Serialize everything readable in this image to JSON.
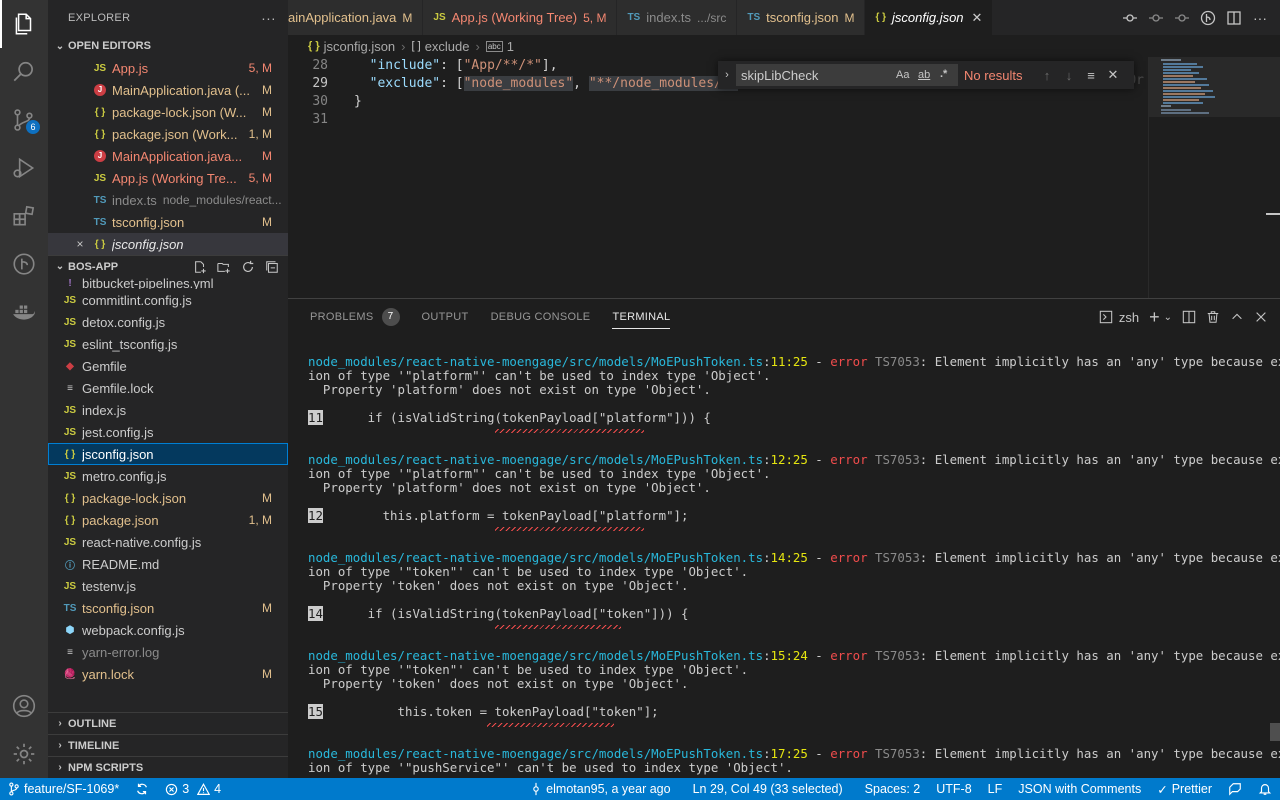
{
  "activity": {
    "scm_badge": "6"
  },
  "sidebar": {
    "title": "EXPLORER",
    "more": "···",
    "open_editors_title": "OPEN EDITORS",
    "open_editors": [
      {
        "icon": "JS",
        "name": "App.js",
        "desc": "",
        "status": "5, M",
        "color": "err"
      },
      {
        "icon": "J",
        "name": "MainApplication.java (...",
        "desc": "",
        "status": "M",
        "color": "mod"
      },
      {
        "icon": "{ }",
        "name": "package-lock.json (W...",
        "desc": "",
        "status": "M",
        "color": "mod"
      },
      {
        "icon": "{ }",
        "name": "package.json (Work...",
        "desc": "",
        "status": "1, M",
        "color": "mod"
      },
      {
        "icon": "J",
        "name": "MainApplication.java...",
        "desc": "",
        "status": "M",
        "color": "err"
      },
      {
        "icon": "JS",
        "name": "App.js (Working Tre...",
        "desc": "",
        "status": "5, M",
        "color": "err"
      },
      {
        "icon": "TS",
        "name": "index.ts",
        "desc": "node_modules/react...",
        "status": "",
        "color": "dim"
      },
      {
        "icon": "TS",
        "name": "tsconfig.json",
        "desc": "",
        "status": "M",
        "color": "mod"
      }
    ],
    "current_editor": {
      "icon": "{ }",
      "name": "jsconfig.json",
      "close": "×"
    },
    "project_title": "BOS-APP",
    "files": [
      {
        "icon": "!",
        "name": "bitbucket-pipelines.yml",
        "status": "",
        "color": "def"
      },
      {
        "icon": "JS",
        "name": "commitlint.config.js",
        "status": "",
        "color": "def"
      },
      {
        "icon": "JS",
        "name": "detox.config.js",
        "status": "",
        "color": "def"
      },
      {
        "icon": "JS",
        "name": "eslint_tsconfig.js",
        "status": "",
        "color": "def"
      },
      {
        "icon": "◆",
        "name": "Gemfile",
        "status": "",
        "color": "def"
      },
      {
        "icon": "≡",
        "name": "Gemfile.lock",
        "status": "",
        "color": "def"
      },
      {
        "icon": "JS",
        "name": "index.js",
        "status": "",
        "color": "def"
      },
      {
        "icon": "JS",
        "name": "jest.config.js",
        "status": "",
        "color": "def"
      },
      {
        "icon": "{ }",
        "name": "jsconfig.json",
        "status": "",
        "color": "def"
      },
      {
        "icon": "JS",
        "name": "metro.config.js",
        "status": "",
        "color": "def"
      },
      {
        "icon": "{ }",
        "name": "package-lock.json",
        "status": "M",
        "color": "mod"
      },
      {
        "icon": "{ }",
        "name": "package.json",
        "status": "1, M",
        "color": "mod"
      },
      {
        "icon": "JS",
        "name": "react-native.config.js",
        "status": "",
        "color": "def"
      },
      {
        "icon": "ⓘ",
        "name": "README.md",
        "status": "",
        "color": "def"
      },
      {
        "icon": "JS",
        "name": "testenv.js",
        "status": "",
        "color": "def"
      },
      {
        "icon": "TS",
        "name": "tsconfig.json",
        "status": "M",
        "color": "mod"
      },
      {
        "icon": "⬢",
        "name": "webpack.config.js",
        "status": "",
        "color": "def"
      },
      {
        "icon": "≡",
        "name": "yarn-error.log",
        "status": "",
        "color": "dim"
      },
      {
        "icon": "🧶",
        "name": "yarn.lock",
        "status": "M",
        "color": "mod"
      }
    ],
    "outline": "OUTLINE",
    "timeline": "TIMELINE",
    "npm_scripts": "NPM SCRIPTS"
  },
  "tabs": [
    {
      "icon": "",
      "label": "ainApplication.java",
      "status": "M",
      "color": "mod"
    },
    {
      "icon": "JS",
      "label": "App.js (Working Tree)",
      "status": "5, M",
      "color": "err"
    },
    {
      "icon": "TS",
      "label": "index.ts",
      "status": ".../src",
      "color": "dim"
    },
    {
      "icon": "TS",
      "label": "tsconfig.json",
      "status": "M",
      "color": "mod"
    },
    {
      "icon": "{ }",
      "label": "jsconfig.json",
      "status": "",
      "color": "active"
    }
  ],
  "breadcrumb": {
    "file_icon": "{ }",
    "file": "jsconfig.json",
    "sep": "›",
    "node_icon": "[ ]",
    "node": "exclude",
    "index_icon": "abc",
    "index": "1"
  },
  "editor": {
    "lines": [
      {
        "n": "28",
        "key": "\"include\"",
        "rest": ": [",
        "vals": [
          "\"App/**/*\""
        ],
        "tail": "],"
      },
      {
        "n": "29",
        "key": "\"exclude\"",
        "rest": ": [",
        "vals": [
          "\"node_modules\"",
          "\"**/node_modules/*\""
        ],
        "tail": "]"
      },
      {
        "n": "30",
        "text": "}"
      },
      {
        "n": "31",
        "text": ""
      }
    ],
    "cursor_line": "29"
  },
  "find": {
    "value": "skipLibCheck",
    "match_case": "Aa",
    "whole_word": "ab",
    "regex": ".*",
    "result": "No results",
    "prev": "↑",
    "next": "↓",
    "menu": "≡",
    "close": "✕",
    "toggle": "›"
  },
  "panel": {
    "tabs": [
      "PROBLEMS",
      "OUTPUT",
      "DEBUG CONSOLE",
      "TERMINAL"
    ],
    "problems_count": "7",
    "shell": "zsh",
    "terminal": [
      {
        "path": "node_modules/react-native-moengage/src/models/MoEPushToken.ts",
        "pos": "11:25",
        "code": "TS7053",
        "msg": "Element implicitly has an 'any' type because express",
        "cont": "ion of type '\"platform\"' can't be used to index type 'Object'.",
        "prop": "  Property 'platform' does not exist on type 'Object'.",
        "ln": "11",
        "src": "      if (isValidString(tokenPayload[\"platform\"])) {",
        "sq_off": 25,
        "sq_len": 20
      },
      {
        "path": "node_modules/react-native-moengage/src/models/MoEPushToken.ts",
        "pos": "12:25",
        "code": "TS7053",
        "msg": "Element implicitly has an 'any' type because express",
        "cont": "ion of type '\"platform\"' can't be used to index type 'Object'.",
        "prop": "  Property 'platform' does not exist on type 'Object'.",
        "ln": "12",
        "src": "        this.platform = tokenPayload[\"platform\"];",
        "sq_off": 25,
        "sq_len": 20
      },
      {
        "path": "node_modules/react-native-moengage/src/models/MoEPushToken.ts",
        "pos": "14:25",
        "code": "TS7053",
        "msg": "Element implicitly has an 'any' type because express",
        "cont": "ion of type '\"token\"' can't be used to index type 'Object'.",
        "prop": "  Property 'token' does not exist on type 'Object'.",
        "ln": "14",
        "src": "      if (isValidString(tokenPayload[\"token\"])) {",
        "sq_off": 25,
        "sq_len": 17
      },
      {
        "path": "node_modules/react-native-moengage/src/models/MoEPushToken.ts",
        "pos": "15:24",
        "code": "TS7053",
        "msg": "Element implicitly has an 'any' type because express",
        "cont": "ion of type '\"token\"' can't be used to index type 'Object'.",
        "prop": "  Property 'token' does not exist on type 'Object'.",
        "ln": "15",
        "src": "          this.token = tokenPayload[\"token\"];",
        "sq_off": 24,
        "sq_len": 17
      },
      {
        "path": "node_modules/react-native-moengage/src/models/MoEPushToken.ts",
        "pos": "17:25",
        "code": "TS7053",
        "msg": "Element implicitly has an 'any' type because express",
        "cont": "ion of type '\"pushService\"' can't be used to index type 'Object'.",
        "prop": "",
        "ln": "",
        "src": "",
        "sq_off": 0,
        "sq_len": 0
      }
    ],
    "error_word": "error",
    "dash": " - "
  },
  "status": {
    "branch": "feature/SF-1069*",
    "errors": "3",
    "warnings": "4",
    "blame": "elmotan95, a year ago",
    "position": "Ln 29, Col 49 (33 selected)",
    "spaces": "Spaces: 2",
    "encoding": "UTF-8",
    "eol": "LF",
    "language": "JSON with Comments",
    "formatter": "Prettier"
  },
  "colors": {
    "accent": "#007acc",
    "modified": "#e2c08d",
    "error": "#f48771"
  }
}
